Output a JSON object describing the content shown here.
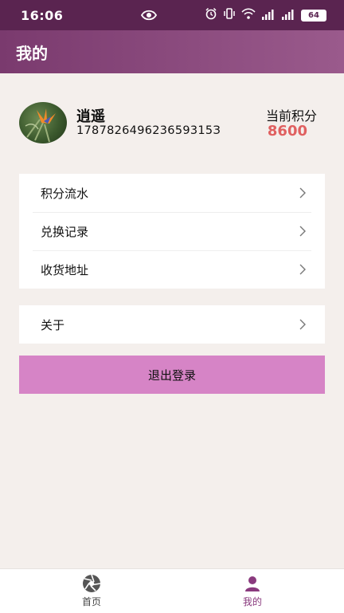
{
  "status_bar": {
    "time": "16:06",
    "battery": "64"
  },
  "header": {
    "title": "我的"
  },
  "profile": {
    "nickname": "逍遥",
    "user_id": "178782649623659315З",
    "points_label": "当前积分",
    "points_value": "8600"
  },
  "menu_group_1": [
    {
      "label": "积分流水"
    },
    {
      "label": "兑换记录"
    },
    {
      "label": "收货地址"
    }
  ],
  "menu_group_2": [
    {
      "label": "关于"
    }
  ],
  "logout_label": "退出登录",
  "tabbar": {
    "items": [
      {
        "label": "首页",
        "icon": "aperture-icon"
      },
      {
        "label": "我的",
        "icon": "person-icon"
      }
    ],
    "active_color": "#8a3a7e"
  },
  "colors": {
    "status_bar": "#5a2450",
    "header": "#8a4a7e",
    "points": "#e06060",
    "logout_button": "#d684c6",
    "background": "#f4efec"
  }
}
